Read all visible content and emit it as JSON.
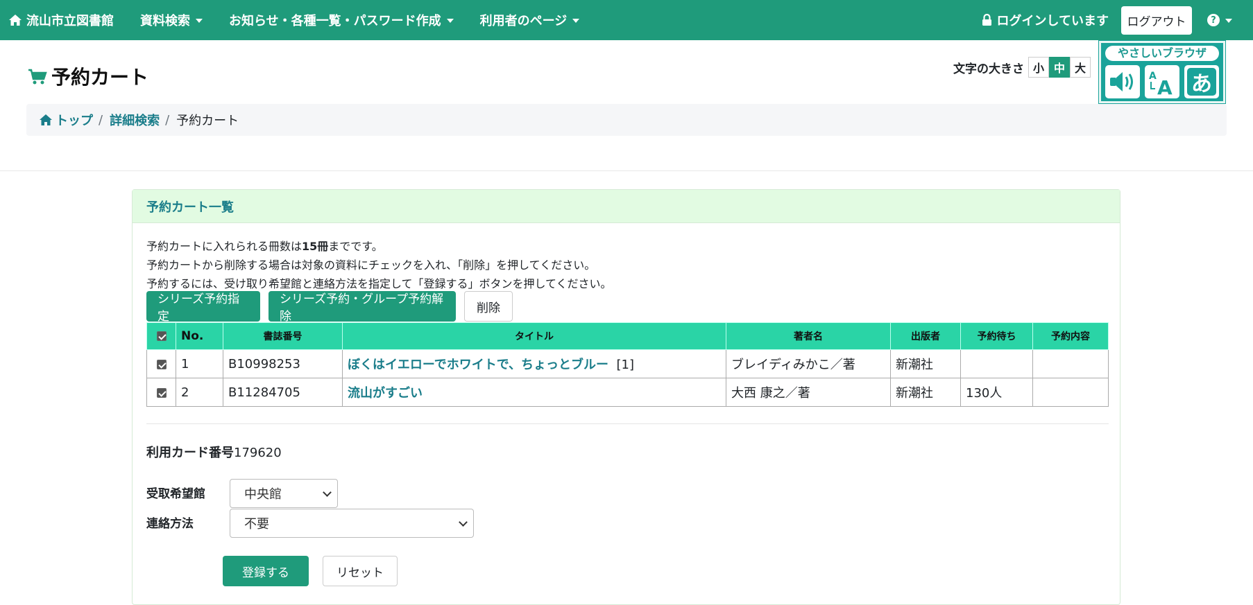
{
  "navbar": {
    "brand": "流山市立図書館",
    "menu": [
      "資料検索",
      "お知らせ・各種一覧・パスワード作成",
      "利用者のページ"
    ],
    "login_status": "ログインしています",
    "logout": "ログアウト",
    "help": "?"
  },
  "page": {
    "title": "予約カート"
  },
  "font_size": {
    "label": "文字の大きさ",
    "small": "小",
    "medium": "中",
    "large": "大",
    "selected": "中"
  },
  "yasashii": {
    "title": "やさしいブラウザ"
  },
  "breadcrumb": {
    "top": "トップ",
    "search": "詳細検索",
    "current": "予約カート",
    "sep": "/"
  },
  "card": {
    "header": "予約カート一覧",
    "info": {
      "line1_pre": "予約カートに入れられる冊数は",
      "line1_bold": "15冊",
      "line1_post": "までです。",
      "line2": "予約カートから削除する場合は対象の資料にチェックを入れ、「削除」を押してください。",
      "line3": "予約するには、受け取り希望館と連絡方法を指定して「登録する」ボタンを押してください。"
    },
    "buttons": {
      "series": "シリーズ予約指定",
      "release": "シリーズ予約・グループ予約解除",
      "delete": "削除"
    },
    "table": {
      "headers": {
        "no": "No.",
        "bib": "書誌番号",
        "title": "タイトル",
        "author": "著者名",
        "publisher": "出版者",
        "wait": "予約待ち",
        "content": "予約内容"
      },
      "rows": [
        {
          "no": "1",
          "bib": "B10998253",
          "title": "ぼくはイエローでホワイトで、ちょっとブルー",
          "vol": "[1]",
          "author": "ブレイディみかこ／著",
          "publisher": "新潮社",
          "wait": "",
          "content": ""
        },
        {
          "no": "2",
          "bib": "B11284705",
          "title": "流山がすごい",
          "vol": "",
          "author": "大西 康之／著",
          "publisher": "新潮社",
          "wait": "130人",
          "content": ""
        }
      ]
    },
    "card_number_label": "利用カード番号",
    "card_number": "179620",
    "pickup_label": "受取希望館",
    "pickup_value": "中央館",
    "contact_label": "連絡方法",
    "contact_value": "不要",
    "submit": "登録する",
    "reset": "リセット"
  }
}
